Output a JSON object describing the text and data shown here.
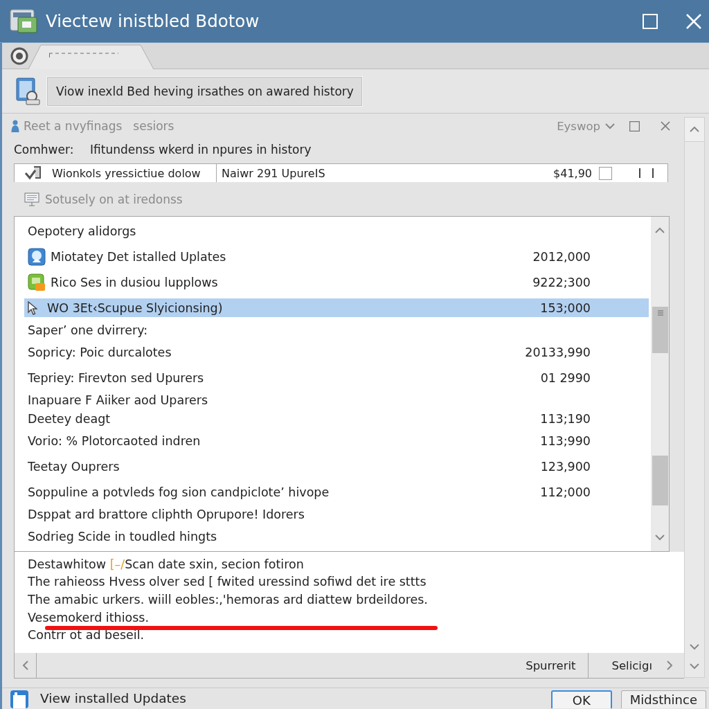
{
  "window": {
    "title": "Viectew inistbled Bdotow"
  },
  "tabs": [
    {
      "selected": true
    }
  ],
  "banner": {
    "text": "Viow inexld Bed heving irsathes on awared history"
  },
  "panel": {
    "title": "Reet a nvyfinags",
    "subtitle": "sesiors",
    "view_menu": "Eyswop",
    "computer_label": "Comhwer:",
    "computer_value": "Ifitundenss wkerd in npures in history",
    "summary_row": {
      "name": "Wionkols yressictiue dolow",
      "detail": "Naiwr 291 UpureIS",
      "amount": "$41,90",
      "checked": false
    },
    "status": "Sotusely on at iredonss"
  },
  "list": {
    "rows": [
      {
        "kind": "line",
        "name": "Oepotery alidorgs",
        "selected": false
      },
      {
        "kind": "app",
        "name": "Miotatey Det istalled Uplates",
        "size": "2012,000",
        "selected": false
      },
      {
        "kind": "package",
        "name": "Rico Ses in dusiou lupplows",
        "size": "9222;300",
        "selected": false
      },
      {
        "kind": "pointer",
        "name": "WO 3Et‹Scupue Slyicionsing)",
        "size": "153;000",
        "selected": true
      },
      {
        "kind": "tight",
        "name": "Saper’ one dvirrery:",
        "selected": false
      },
      {
        "kind": "line",
        "name": "Sopricy: Poic durcalotes",
        "size": "20133,990",
        "selected": false
      },
      {
        "kind": "line",
        "name": "Tepriey: Firevton sed Upurers",
        "size": "01 2990",
        "selected": false
      },
      {
        "kind": "tight",
        "name": "Inapuare F Aiiker aod Uparers",
        "selected": false
      },
      {
        "kind": "tight",
        "name": "Deetey deagt",
        "size": "113;190",
        "selected": false
      },
      {
        "kind": "line",
        "name": "Vorio: % Plotorcaoted indren",
        "size": "113;990",
        "selected": false
      },
      {
        "kind": "line",
        "name": "Teetay Ouprers",
        "size": "123,900",
        "selected": false
      },
      {
        "kind": "line",
        "name": "Soppuline a potvleds fog sion candpiclote’ hivope",
        "size": "112;000",
        "selected": false
      },
      {
        "kind": "tight",
        "name": "Dsppat ard brattore cliphth Oprupore! Idorers",
        "selected": false
      },
      {
        "kind": "line",
        "name": "Sodrieg Scide in toudled hingts",
        "selected": false
      }
    ]
  },
  "description": {
    "first_line": {
      "lead": "Destawhitow ",
      "mark": "[–/",
      "rest": "Scan date sxin, secion fotiron"
    },
    "lines": [
      "The rahieoss Hvess olver sed [ fwited uressind sofiwd det ire sttts",
      "The amabic urkers. wiill eobles:,'hemoras ard diattew brdeildores.",
      "Vesemokerd ithioss.",
      "Contrr ot ad beseil."
    ]
  },
  "footer": {
    "buttons": [
      "Spurrerit",
      "Selicigı"
    ]
  },
  "status_bar": {
    "text": "View installed Updates",
    "buttons": [
      {
        "label": "OK",
        "focused": true
      },
      {
        "label": "Midsthince",
        "focused": false
      }
    ]
  }
}
